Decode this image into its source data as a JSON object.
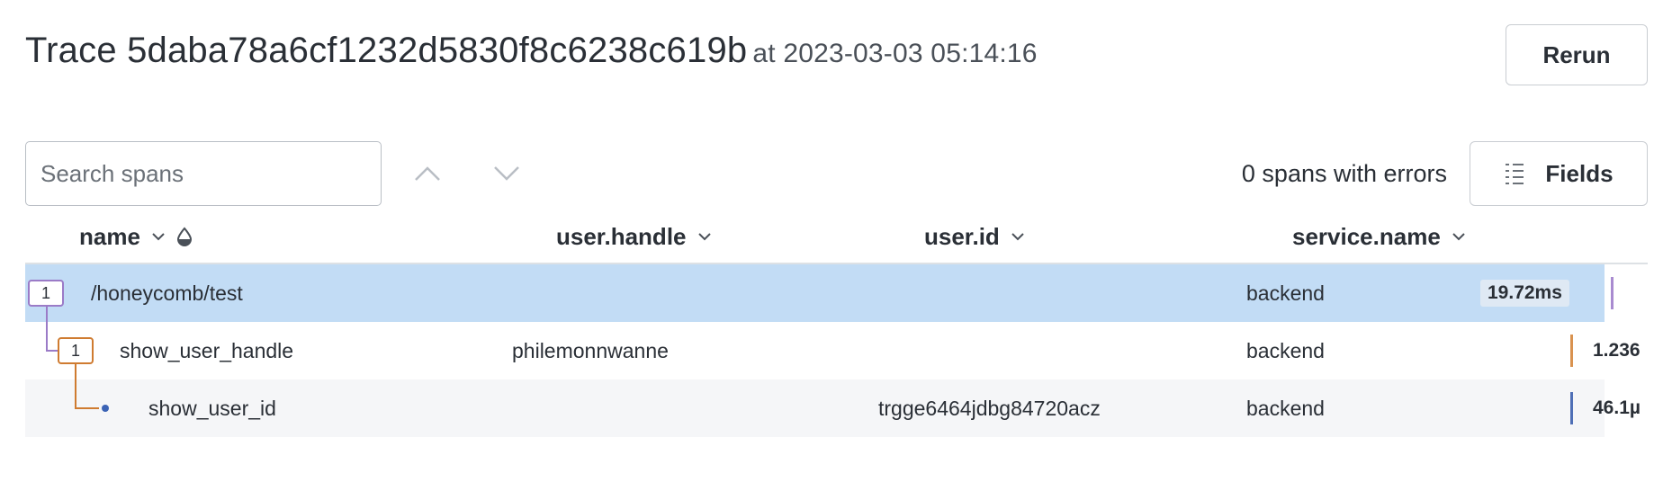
{
  "header": {
    "title": "Trace 5daba78a6cf1232d5830f8c6238c619b",
    "timestamp": "at 2023-03-03 05:14:16",
    "rerun_label": "Rerun"
  },
  "toolbar": {
    "search_placeholder": "Search spans",
    "errors_text": "0 spans with errors",
    "fields_label": "Fields"
  },
  "columns": [
    {
      "label": "name"
    },
    {
      "label": "user.handle"
    },
    {
      "label": "user.id"
    },
    {
      "label": "service.name"
    }
  ],
  "rows": [
    {
      "badge": "1",
      "name": "/honeycomb/test",
      "user_handle": "",
      "user_id": "",
      "service": "backend",
      "duration": "19.72ms",
      "color": "#a98bd0",
      "selected": true
    },
    {
      "badge": "1",
      "name": "show_user_handle",
      "user_handle": "philemonnwanne",
      "user_id": "",
      "service": "backend",
      "duration": "1.236",
      "color": "#d9924f"
    },
    {
      "badge": "",
      "name": "show_user_id",
      "user_handle": "",
      "user_id": "trgge6464jdbg84720acz",
      "service": "backend",
      "duration": "46.1µ",
      "color": "#4f6fb6"
    }
  ],
  "colors": {
    "selected_row": "#c2dcf5",
    "badge_root": "#9b7bc7",
    "badge_child": "#cf7b30",
    "dot": "#3b63b5"
  },
  "icons": [
    "chevron-up-icon",
    "chevron-down-icon",
    "sort-chevron-icon",
    "droplet-icon",
    "fields-list-icon"
  ]
}
